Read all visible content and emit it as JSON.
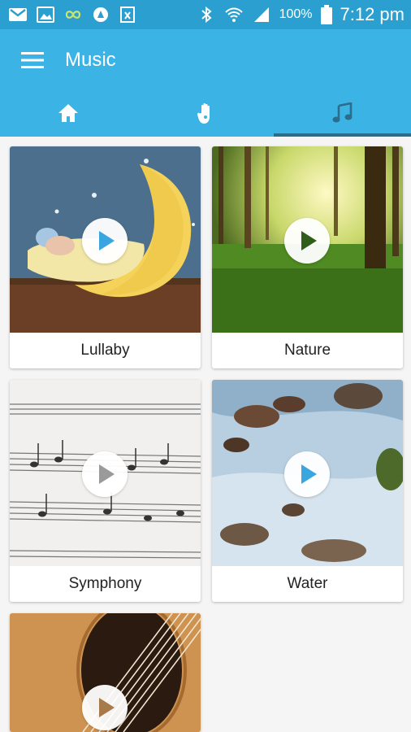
{
  "status_bar": {
    "battery": "100%",
    "time": "7:12 pm",
    "left_icons": [
      "gmail-icon",
      "gallery-icon",
      "infinity-icon",
      "clipboard-icon",
      "excel-icon"
    ],
    "right_icons": [
      "bluetooth-icon",
      "wifi-icon",
      "signal-icon",
      "battery-icon"
    ]
  },
  "app_bar": {
    "title": "Music",
    "tabs": [
      {
        "name": "home",
        "icon": "home-icon",
        "active": false
      },
      {
        "name": "hand",
        "icon": "hand-icon",
        "active": false
      },
      {
        "name": "music",
        "icon": "music-note-icon",
        "active": true
      }
    ]
  },
  "colors": {
    "status_bar": "#2a9fd0",
    "app_bar": "#3bb4e5",
    "active_indicator": "#2b6d8c",
    "play_icon": "#3aa6df"
  },
  "cards": [
    {
      "label": "Lullaby",
      "image": "baby-on-moon"
    },
    {
      "label": "Nature",
      "image": "sunlit-forest"
    },
    {
      "label": "Symphony",
      "image": "sheet-music"
    },
    {
      "label": "Water",
      "image": "rocky-stream"
    },
    {
      "label": "",
      "image": "acoustic-guitar"
    }
  ]
}
